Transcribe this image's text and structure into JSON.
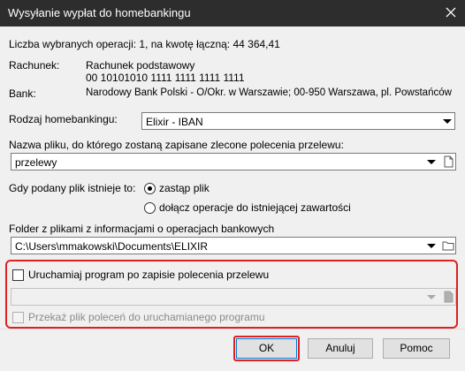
{
  "window": {
    "title": "Wysyłanie wypłat do homebankingu"
  },
  "summary": {
    "text": "Liczba wybranych operacji: 1, na kwotę łączną: 44 364,41"
  },
  "account": {
    "label": "Rachunek:",
    "name": "Rachunek podstawowy",
    "number": "00 10101010 1111 1111 1111 1111"
  },
  "bank": {
    "label": "Bank:",
    "value": "Narodowy Bank Polski  - O/Okr. w Warszawie; 00-950 Warszawa, pl. Powstańców"
  },
  "homebanking": {
    "label": "Rodzaj homebankingu:",
    "selected": "Elixir - IBAN"
  },
  "filename": {
    "label": "Nazwa pliku, do którego zostaną zapisane zlecone polecenia przelewu:",
    "value": "przelewy"
  },
  "exists": {
    "label": "Gdy podany plik istnieje to:",
    "options": [
      "zastąp plik",
      "dołącz operacje do istniejącej zawartości"
    ],
    "selected_index": 0
  },
  "folder": {
    "label": "Folder z plikami z informacjami o operacjach bankowych",
    "value": "C:\\Users\\mmakowski\\Documents\\ELIXIR"
  },
  "run_program": {
    "label": "Uruchamiaj program po zapisie polecenia przelewu",
    "checked": false,
    "program_path": "",
    "pass_file_label": "Przekaż plik poleceń do uruchamianego programu",
    "pass_file_checked": false
  },
  "buttons": {
    "ok": "OK",
    "cancel": "Anuluj",
    "help": "Pomoc"
  },
  "colors": {
    "highlight": "#e02020",
    "titlebar": "#2d2d2d",
    "focus": "#0078d7"
  }
}
